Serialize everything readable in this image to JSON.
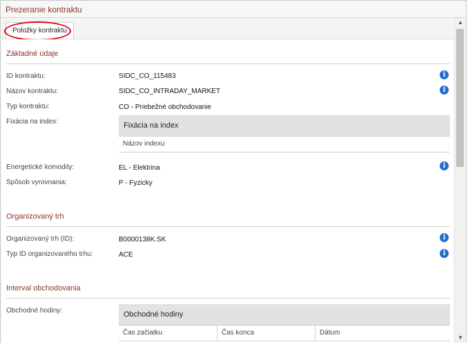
{
  "window": {
    "title": "Prezeranie kontraktu"
  },
  "tabs": [
    {
      "label": "Položky kontraktu"
    }
  ],
  "sections": {
    "basic": {
      "title": "Základné údaje",
      "id_label": "ID kontraktu:",
      "id_value": "SIDC_CO_115483",
      "name_label": "Názov kontraktu:",
      "name_value": "SIDC_CO_INTRADAY_MARKET",
      "type_label": "Typ kontraktu:",
      "type_value": "CO - Priebežné obchodovanie",
      "fix_label": "Fixácia na index:",
      "fix_table": {
        "header": "Fixácia na index",
        "column": "Názov indexu"
      },
      "energy_label": "Energetické komodity:",
      "energy_value": "EL - Elektrina",
      "settle_label": "Spôsob vyrovnania:",
      "settle_value": "P - Fyzicky"
    },
    "market": {
      "title": "Organizovaný trh",
      "id_label": "Organizovaný trh (ID):",
      "id_value": "B0000138K.SK",
      "type_label": "Typ ID organizovaného trhu:",
      "type_value": "ACE"
    },
    "interval": {
      "title": "Interval obchodovania",
      "hours_label": "Obchodné hodiny:",
      "hours_table": {
        "header": "Obchodné hodiny",
        "columns": [
          "Čas začiatku",
          "Čas konca",
          "Dátum"
        ]
      }
    }
  },
  "icons": {
    "info": "info-icon",
    "info_glyph": "i"
  },
  "colors": {
    "accent": "#8a3324",
    "info": "#1e6fd1",
    "highlight": "#e0001b"
  }
}
